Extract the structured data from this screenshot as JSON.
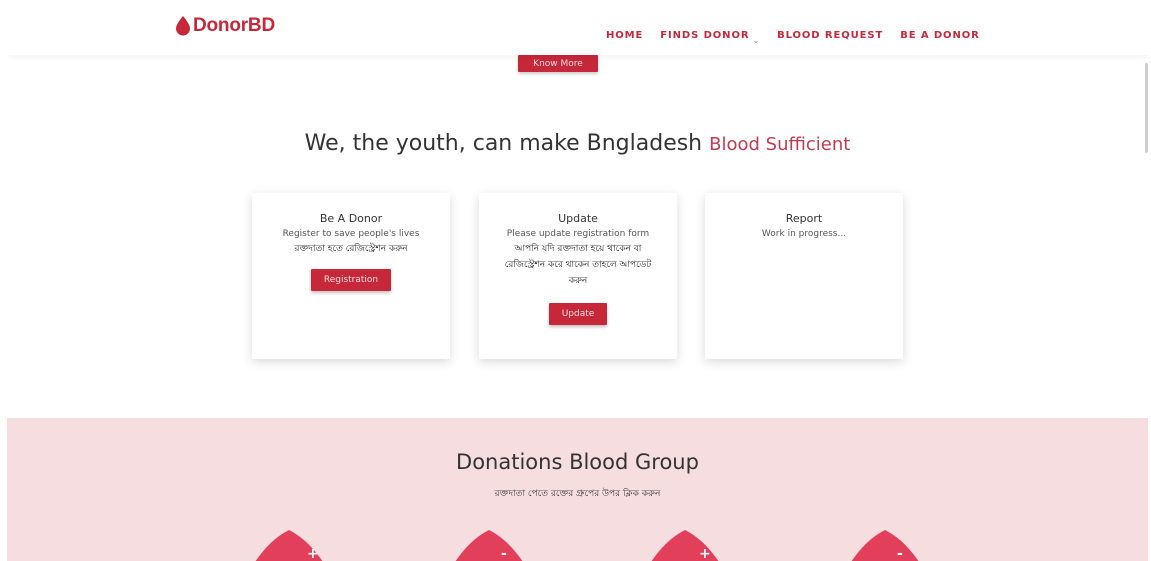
{
  "brand": {
    "name": "DonorBD",
    "color": "#c6283a"
  },
  "nav": {
    "items": [
      {
        "label": "HOME"
      },
      {
        "label": "FINDS DONOR"
      },
      {
        "label": "BLOOD REQUEST"
      },
      {
        "label": "BE A DONOR"
      }
    ],
    "dropdown_icon": "chevron-down-icon"
  },
  "hero": {
    "know_more_label": "Know More"
  },
  "headline": {
    "main": "We, the youth, can make Bngladesh",
    "accent": "Blood Sufficient"
  },
  "cards": [
    {
      "title": "Be A Donor",
      "line": "Register to save people's lives",
      "bengali": "রক্তদাতা হতে রেজিস্ট্রেশন করুন",
      "button": "Registration"
    },
    {
      "title": "Update",
      "line": "Please update registration form",
      "bengali": "আপনি যদি রক্তদাতা হয়ে থাকেন বা রেজিস্ট্রেশন করে থাকেন তাহলে আপডেট করুন",
      "button": "Update"
    },
    {
      "title": "Report",
      "line": "Work in progress..."
    }
  ],
  "blood_groups": {
    "title": "Donations Blood Group",
    "subtitle": "রক্তদাতা পেতে রক্তের গ্রুপের উপর ক্লিক করুন",
    "drops": [
      {
        "sign": "+"
      },
      {
        "sign": "-"
      },
      {
        "sign": "+"
      },
      {
        "sign": "-"
      }
    ]
  },
  "colors": {
    "accent": "#c6283a",
    "pink_bg": "#f6dde0",
    "drop": "#e2405a"
  }
}
